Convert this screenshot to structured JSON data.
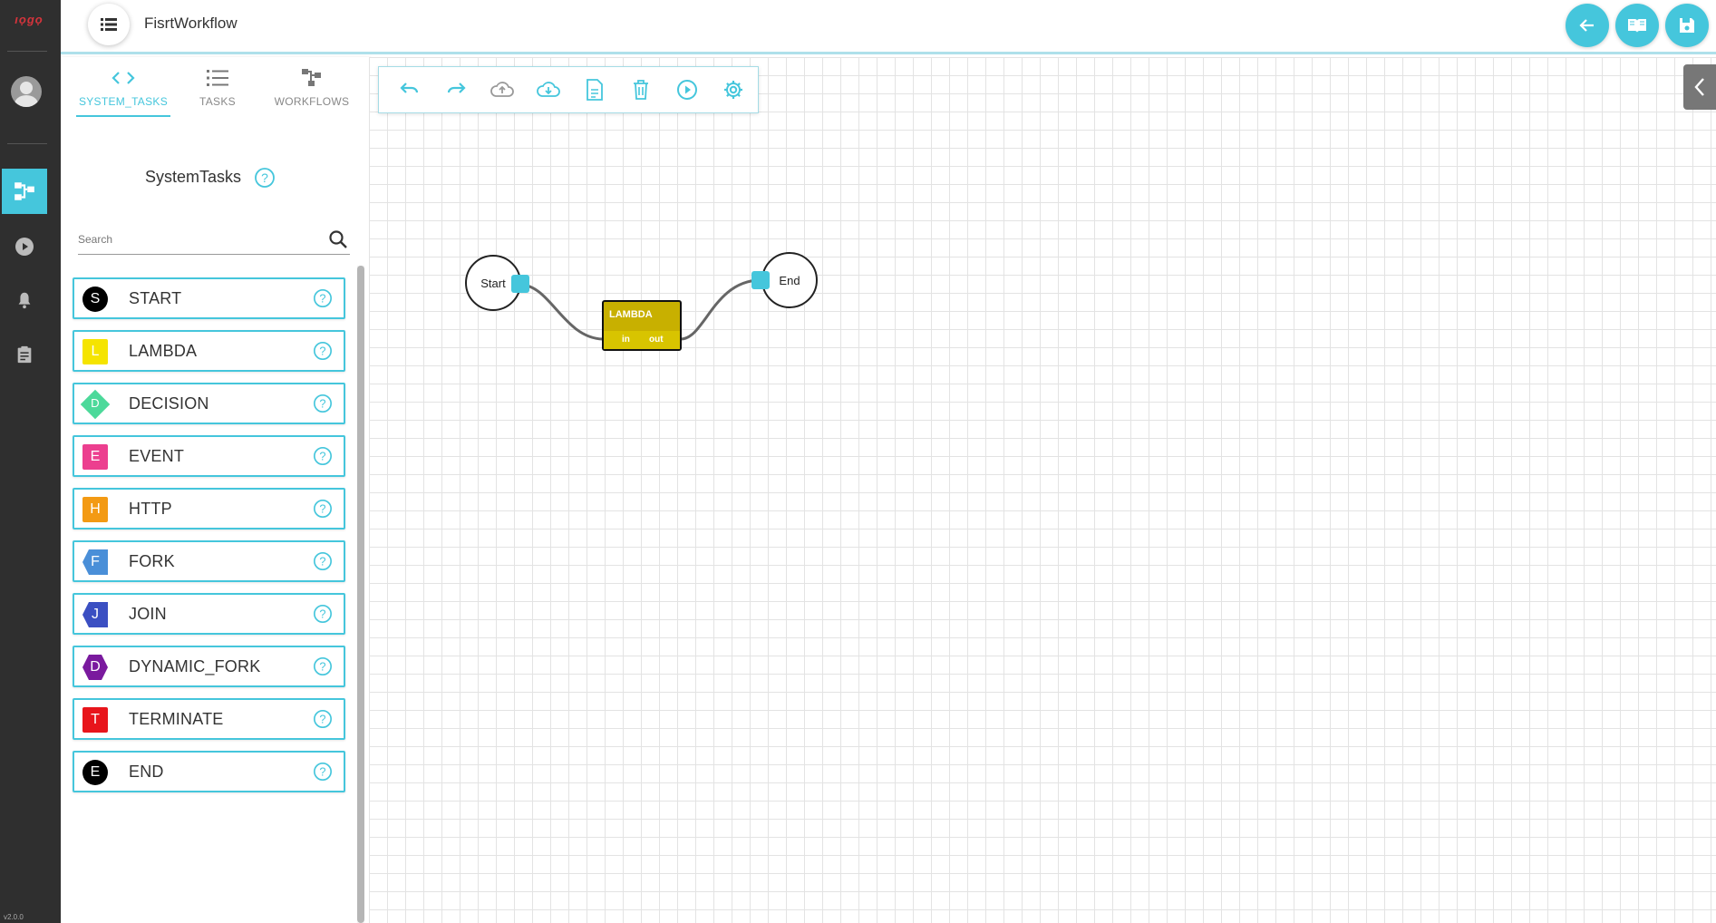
{
  "app": {
    "logo_text": "ıọgọ",
    "version": "v2.0.0"
  },
  "header": {
    "title": "FisrtWorkflow"
  },
  "panel": {
    "tabs": [
      {
        "label": "SYSTEM_TASKS",
        "icon": "code-icon",
        "active": true
      },
      {
        "label": "TASKS",
        "icon": "list-icon",
        "active": false
      },
      {
        "label": "WORKFLOWS",
        "icon": "workflow-icon",
        "active": false
      }
    ],
    "section_title": "SystemTasks",
    "search": {
      "placeholder": "Search",
      "value": ""
    },
    "tasks": [
      {
        "label": "START",
        "letter": "S",
        "color": "#000000",
        "shape": "circle"
      },
      {
        "label": "LAMBDA",
        "letter": "L",
        "color": "#f5e400",
        "shape": "square"
      },
      {
        "label": "DECISION",
        "letter": "D",
        "color": "#4cd99a",
        "shape": "diamond"
      },
      {
        "label": "EVENT",
        "letter": "E",
        "color": "#ec3f8f",
        "shape": "square"
      },
      {
        "label": "HTTP",
        "letter": "H",
        "color": "#f39a14",
        "shape": "square"
      },
      {
        "label": "FORK",
        "letter": "F",
        "color": "#4a8fd8",
        "shape": "arrow"
      },
      {
        "label": "JOIN",
        "letter": "J",
        "color": "#3b4fc2",
        "shape": "arrow"
      },
      {
        "label": "DYNAMIC_FORK",
        "letter": "D",
        "color": "#7a1a9e",
        "shape": "hexagon"
      },
      {
        "label": "TERMINATE",
        "letter": "T",
        "color": "#e8151b",
        "shape": "square"
      },
      {
        "label": "END",
        "letter": "E",
        "color": "#000000",
        "shape": "circle"
      }
    ]
  },
  "canvas": {
    "nodes": {
      "start": {
        "label": "Start"
      },
      "lambda": {
        "label": "LAMBDA",
        "in": "in",
        "out": "out"
      },
      "end": {
        "label": "End"
      }
    }
  },
  "colors": {
    "accent": "#45c6dc",
    "rail": "#2f2f2f",
    "lambda": "#c8b000"
  }
}
